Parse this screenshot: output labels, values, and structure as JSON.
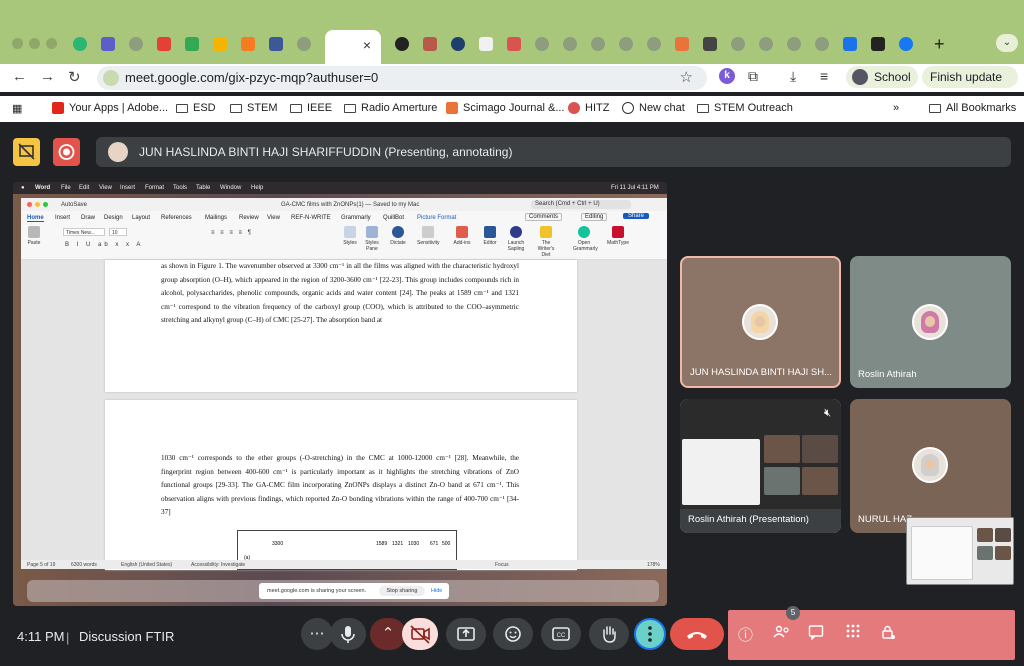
{
  "browser": {
    "active_tab_close": "×",
    "new_tab": "+",
    "url": "meet.google.com/gix-pzyc-mqp?authuser=0",
    "profile_label": "School",
    "update_label": "Finish update",
    "extension_letter": "k"
  },
  "bookmarks": [
    {
      "label": "Your Apps | Adobe...",
      "icon": "adobe-icon"
    },
    {
      "label": "ESD",
      "icon": "folder-icon"
    },
    {
      "label": "STEM",
      "icon": "folder-icon"
    },
    {
      "label": "IEEE",
      "icon": "folder-icon"
    },
    {
      "label": "Radio Amerture",
      "icon": "folder-icon"
    },
    {
      "label": "Scimago Journal &...",
      "icon": "scimago-icon"
    },
    {
      "label": "HITZ",
      "icon": "hitz-icon"
    },
    {
      "label": "New chat",
      "icon": "chatgpt-icon"
    },
    {
      "label": "STEM Outreach",
      "icon": "folder-icon"
    }
  ],
  "bookmarks_overflow": "»",
  "bookmarks_all": "All Bookmarks",
  "meet": {
    "presenter_banner": "JUN HASLINDA BINTI HAJI SHARIFFUDDIN (Presenting, annotating)",
    "clock": "4:11 PM",
    "divider": "|",
    "meeting_name": "Discussion FTIR",
    "participant_count": "5",
    "colors": {
      "banner_btn_yellow": "#f6c443",
      "record_red": "#e2544b",
      "panel_red": "#e47a7c",
      "leave_red": "#e2544b",
      "speaking_border": "#f1b7a8"
    }
  },
  "participants": [
    {
      "name": "JUN HASLINDA BINTI HAJI SH...",
      "tile_color": "#8c7467"
    },
    {
      "name": "Roslin Athirah",
      "tile_color": "#7e8b86"
    },
    {
      "name": "Roslin Athirah (Presentation)",
      "tile_color": "#ffffff"
    },
    {
      "name": "NURUL HAZ",
      "tile_color": "#7a6456"
    }
  ],
  "shared_screen": {
    "menubar": {
      "app": "Word",
      "menus": [
        "File",
        "Edit",
        "View",
        "Insert",
        "Format",
        "Tools",
        "Table",
        "Window",
        "Help"
      ],
      "datetime": "Fri 11 Jul  4:11 PM"
    },
    "word": {
      "autosave": "AutoSave",
      "doc_title": "GA-CMC films with ZnONPs(1) — Saved to my Mac",
      "search_placeholder": "Search (Cmd + Ctrl + U)",
      "tabs": [
        "Home",
        "Insert",
        "Draw",
        "Design",
        "Layout",
        "References",
        "Mailings",
        "Review",
        "View",
        "REF-N-WRITE",
        "Grammarly",
        "QuillBot",
        "Picture Format"
      ],
      "comments": "Comments",
      "editing": "Editing",
      "share": "Share",
      "font_name": "Times New...",
      "font_size": "10",
      "ribbon_items": [
        "Paste",
        "Styles",
        "Styles Pane",
        "Dictate",
        "Sensitivity",
        "Add-ins",
        "Editor",
        "Launch Sapling",
        "The Writer's Diet",
        "Open Grammarly",
        "MathType"
      ],
      "page1_text": "as shown in Figure 1. The wavenumber observed at 3300 cm⁻¹ in all the films was aligned with the characteristic hydroxyl group absorption (O–H), which appeared in the region of 3200-3600 cm⁻¹ [22-23]. This group includes compounds rich in alcohol, polysaccharides, phenolic compounds, organic acids and water content [24]. The peaks at 1589 cm⁻¹ and 1321 cm⁻¹ correspond to the vibration frequency of the carboxyl group (COO), which is attributed to the COO–asymmetric stretching and alkynyl group (C–H) of CMC [25-27]. The absorption band at",
      "page2_text": "1030 cm⁻¹ corresponds to the ether groups (-O-stretching) in the CMC at 1000-12000 cm⁻¹ [28]. Meanwhile, the fingerprint region between 400-600 cm⁻¹ is particularly important as it highlights the stretching vibrations of ZnO functional groups [29-33]. The GA-CMC film incorporating ZnONPs displays a distinct Zn-O band at 671 cm⁻¹. This observation aligns with previous findings, which reported Zn-O bonding vibrations within the range of 400-700 cm⁻¹ [34-37]",
      "figure_labels": [
        "3300",
        "1589",
        "1321",
        "1030",
        "671",
        "500",
        "(a)"
      ],
      "status": {
        "page": "Page 5 of 19",
        "words": "6300 words",
        "language": "English (United States)",
        "accessibility": "Accessibility: Investigate",
        "focus": "Focus",
        "zoom": "178%"
      }
    },
    "share_notice": {
      "text": "meet.google.com is sharing your screen.",
      "stop": "Stop sharing",
      "hide": "Hide"
    }
  }
}
